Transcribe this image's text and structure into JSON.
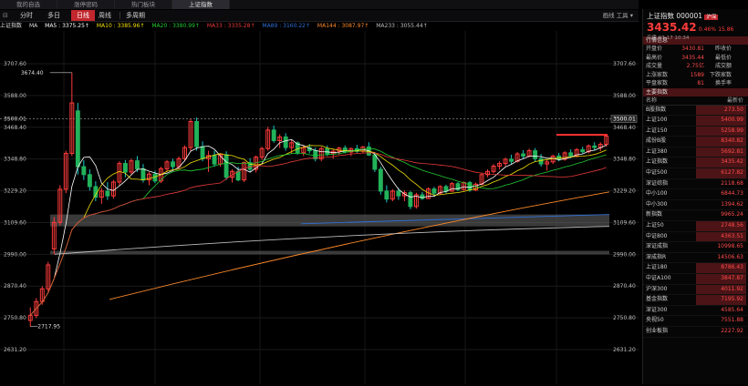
{
  "tabs": [
    {
      "label": "我的自选",
      "active": false
    },
    {
      "label": "涨停密码",
      "active": false
    },
    {
      "label": "热门板块",
      "active": false
    },
    {
      "label": "上证指数",
      "active": true
    }
  ],
  "toolbar": {
    "items": [
      "分时",
      "多日",
      "日线",
      "周线",
      "多周期"
    ],
    "selected_index": 2,
    "right": "画线  工具 ▾"
  },
  "indicators": {
    "symbol": "上证指数",
    "ma": "MA",
    "ma5": "MA5 : 3375.25↑",
    "ma10": "MA10 : 3385.96↑",
    "ma20": "MA20 : 3380.99↑",
    "ma33": "MA33 : 3335.28↑",
    "ma89": "MA89 : 3160.22↑",
    "ma144": "MA144 : 3087.97↑",
    "ma233": "MA233 : 3055.44↑",
    "colors": {
      "ma5": "#ffffff",
      "ma10": "#f3e000",
      "ma20": "#22cc33",
      "ma33": "#e83a3a",
      "ma89": "#2f6fd6",
      "ma144": "#ff8a2a",
      "ma233": "#bbbbbb"
    }
  },
  "chart_data": {
    "type": "candlestick",
    "ylim": [
      2631.2,
      3707.6
    ],
    "yticks": [
      "3707.60",
      "3588.00",
      "3468.40",
      "3348.80",
      "3229.20",
      "3109.60",
      "2990.00",
      "2870.40",
      "2750.80",
      "2631.20"
    ],
    "current_price_label": "3500.01",
    "annotations": [
      "3674.40",
      "2717.95"
    ],
    "zones": [
      {
        "low": 3095,
        "high": 3140
      },
      {
        "low": 2990,
        "high": 3003
      }
    ],
    "candles": [
      [
        2741,
        2790,
        2718,
        2760
      ],
      [
        2760,
        2825,
        2750,
        2812
      ],
      [
        2812,
        2870,
        2800,
        2860
      ],
      [
        2860,
        2962,
        2850,
        2950
      ],
      [
        3010,
        3130,
        2990,
        3110
      ],
      [
        3110,
        3250,
        3100,
        3235
      ],
      [
        3235,
        3380,
        3220,
        3370
      ],
      [
        3370,
        3674,
        3360,
        3560
      ],
      [
        3530,
        3560,
        3290,
        3320
      ],
      [
        3320,
        3345,
        3270,
        3290
      ],
      [
        3290,
        3310,
        3230,
        3245
      ],
      [
        3245,
        3265,
        3190,
        3205
      ],
      [
        3205,
        3240,
        3180,
        3228
      ],
      [
        3228,
        3262,
        3195,
        3210
      ],
      [
        3210,
        3270,
        3200,
        3262
      ],
      [
        3262,
        3340,
        3250,
        3332
      ],
      [
        3332,
        3345,
        3280,
        3300
      ],
      [
        3300,
        3350,
        3290,
        3342
      ],
      [
        3342,
        3360,
        3300,
        3312
      ],
      [
        3312,
        3330,
        3260,
        3270
      ],
      [
        3270,
        3300,
        3250,
        3292
      ],
      [
        3292,
        3305,
        3258,
        3266
      ],
      [
        3266,
        3320,
        3258,
        3312
      ],
      [
        3312,
        3345,
        3300,
        3338
      ],
      [
        3338,
        3350,
        3310,
        3320
      ],
      [
        3320,
        3358,
        3310,
        3350
      ],
      [
        3350,
        3400,
        3340,
        3392
      ],
      [
        3392,
        3500,
        3380,
        3490
      ],
      [
        3490,
        3505,
        3380,
        3395
      ],
      [
        3395,
        3415,
        3340,
        3350
      ],
      [
        3350,
        3380,
        3300,
        3362
      ],
      [
        3362,
        3380,
        3320,
        3330
      ],
      [
        3330,
        3370,
        3320,
        3365
      ],
      [
        3365,
        3378,
        3270,
        3280
      ],
      [
        3280,
        3310,
        3260,
        3302
      ],
      [
        3302,
        3320,
        3265,
        3270
      ],
      [
        3270,
        3340,
        3262,
        3335
      ],
      [
        3335,
        3352,
        3300,
        3310
      ],
      [
        3310,
        3362,
        3298,
        3356
      ],
      [
        3356,
        3395,
        3345,
        3388
      ],
      [
        3388,
        3470,
        3380,
        3458
      ],
      [
        3458,
        3475,
        3410,
        3418
      ],
      [
        3418,
        3442,
        3390,
        3432
      ],
      [
        3432,
        3446,
        3380,
        3392
      ],
      [
        3392,
        3420,
        3370,
        3410
      ],
      [
        3410,
        3415,
        3365,
        3372
      ],
      [
        3372,
        3400,
        3360,
        3392
      ],
      [
        3392,
        3405,
        3370,
        3380
      ],
      [
        3380,
        3392,
        3340,
        3350
      ],
      [
        3350,
        3395,
        3340,
        3388
      ],
      [
        3388,
        3400,
        3360,
        3368
      ],
      [
        3368,
        3385,
        3350,
        3378
      ],
      [
        3378,
        3395,
        3365,
        3390
      ],
      [
        3390,
        3400,
        3370,
        3375
      ],
      [
        3375,
        3392,
        3360,
        3388
      ],
      [
        3388,
        3402,
        3372,
        3378
      ],
      [
        3378,
        3398,
        3370,
        3394
      ],
      [
        3394,
        3412,
        3360,
        3364
      ],
      [
        3364,
        3372,
        3300,
        3310
      ],
      [
        3310,
        3320,
        3215,
        3228
      ],
      [
        3228,
        3250,
        3185,
        3198
      ],
      [
        3198,
        3235,
        3190,
        3228
      ],
      [
        3228,
        3240,
        3195,
        3210
      ],
      [
        3210,
        3230,
        3190,
        3222
      ],
      [
        3222,
        3228,
        3160,
        3170
      ],
      [
        3170,
        3222,
        3162,
        3214
      ],
      [
        3214,
        3225,
        3195,
        3200
      ],
      [
        3200,
        3242,
        3198,
        3236
      ],
      [
        3236,
        3244,
        3210,
        3220
      ],
      [
        3220,
        3250,
        3214,
        3245
      ],
      [
        3245,
        3252,
        3220,
        3228
      ],
      [
        3228,
        3262,
        3225,
        3256
      ],
      [
        3256,
        3262,
        3228,
        3234
      ],
      [
        3234,
        3264,
        3230,
        3260
      ],
      [
        3260,
        3266,
        3225,
        3232
      ],
      [
        3232,
        3260,
        3228,
        3254
      ],
      [
        3254,
        3296,
        3250,
        3290
      ],
      [
        3290,
        3310,
        3280,
        3302
      ],
      [
        3302,
        3330,
        3295,
        3322
      ],
      [
        3322,
        3340,
        3310,
        3332
      ],
      [
        3332,
        3354,
        3322,
        3348
      ],
      [
        3348,
        3365,
        3330,
        3340
      ],
      [
        3340,
        3375,
        3335,
        3368
      ],
      [
        3368,
        3382,
        3350,
        3360
      ],
      [
        3360,
        3388,
        3355,
        3380
      ],
      [
        3380,
        3390,
        3340,
        3350
      ],
      [
        3350,
        3368,
        3320,
        3330
      ],
      [
        3330,
        3345,
        3305,
        3338
      ],
      [
        3338,
        3365,
        3330,
        3360
      ],
      [
        3360,
        3372,
        3340,
        3348
      ],
      [
        3348,
        3378,
        3342,
        3372
      ],
      [
        3372,
        3385,
        3352,
        3360
      ],
      [
        3360,
        3390,
        3355,
        3384
      ],
      [
        3384,
        3395,
        3370,
        3376
      ],
      [
        3376,
        3404,
        3370,
        3398
      ],
      [
        3398,
        3412,
        3380,
        3392
      ],
      [
        3392,
        3412,
        3378,
        3404
      ],
      [
        3404,
        3438,
        3395,
        3435
      ]
    ]
  },
  "quote": {
    "title": "上证指数 000001",
    "badge": "沪深",
    "price": "3435.42",
    "change_pct": "0.46%",
    "change": "15.86",
    "status": "平盘",
    "date": "03-17",
    "time": "10:34",
    "section_title": "行情信息",
    "rows": [
      {
        "k": "开盘价",
        "v": "3430.81",
        "k2": "昨收价"
      },
      {
        "k": "最高价",
        "v": "3435.44",
        "k2": "最低价"
      },
      {
        "k": "成交量",
        "v": "2.75亿",
        "k2": "成交额"
      },
      {
        "k": "上涨家数",
        "v": "1589",
        "k2": "下跌家数"
      },
      {
        "k": "平盘家数",
        "v": "81",
        "k2": "换手率"
      }
    ]
  },
  "index_list": {
    "section_title": "主要指数",
    "col_name": "名称",
    "col_price": "最新价",
    "rows": [
      {
        "name": "B股指数",
        "price": "273.50",
        "hl": true
      },
      {
        "name": "上证100",
        "price": "5400.99",
        "hl": true
      },
      {
        "name": "上证150",
        "price": "5258.99",
        "hl": true
      },
      {
        "name": "成份B股",
        "price": "8340.82",
        "hl": true
      },
      {
        "name": "上证380",
        "price": "5692.81",
        "hl": true
      },
      {
        "name": "上证指数",
        "price": "3435.42",
        "hl": true
      },
      {
        "name": "中证500",
        "price": "6127.82",
        "hl": true
      },
      {
        "name": "深证综指",
        "price": "2118.68",
        "hl": false
      },
      {
        "name": "中小100",
        "price": "6844.73",
        "hl": false
      },
      {
        "name": "中小300",
        "price": "1394.62",
        "hl": false
      },
      {
        "name": "新指数",
        "price": "9965.24",
        "hl": false
      },
      {
        "name": "上证50",
        "price": "2748.56",
        "hl": true
      },
      {
        "name": "中证800",
        "price": "4363.51",
        "hl": true
      },
      {
        "name": "深证成指",
        "price": "10998.65",
        "hl": false
      },
      {
        "name": "深成指R",
        "price": "14506.63",
        "hl": false
      },
      {
        "name": "上证180",
        "price": "8786.43",
        "hl": true
      },
      {
        "name": "中证A100",
        "price": "3847.87",
        "hl": true
      },
      {
        "name": "沪深300",
        "price": "4011.92",
        "hl": true
      },
      {
        "name": "基金指数",
        "price": "7195.92",
        "hl": true
      },
      {
        "name": "深证300",
        "price": "4585.64",
        "hl": false
      },
      {
        "name": "央视50",
        "price": "7551.88",
        "hl": false
      },
      {
        "name": "创业板指",
        "price": "2227.92",
        "hl": false
      }
    ]
  }
}
